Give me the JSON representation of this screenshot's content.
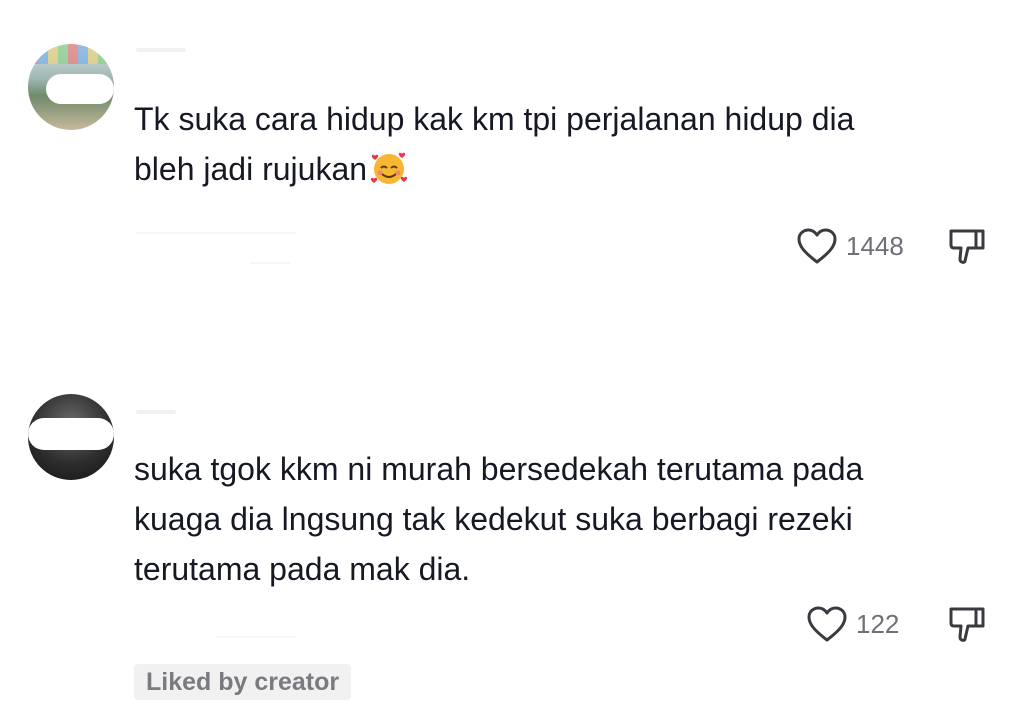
{
  "comments": [
    {
      "avatar_icon": "user-avatar",
      "text": "Tk suka cara hidup kak km tpi perjalanan hidup dia\nbleh jadi rujukan",
      "emoji": "smiling-face-with-hearts",
      "like_icon": "heart-outline-icon",
      "like_count": "1448",
      "dislike_icon": "thumbs-down-icon"
    },
    {
      "avatar_icon": "user-avatar",
      "text": "suka tgok kkm ni murah bersedekah terutama pada\nkuaga dia lngsung tak kedekut suka berbagi rezeki\nterutama pada mak dia.",
      "like_icon": "heart-outline-icon",
      "like_count": "122",
      "dislike_icon": "thumbs-down-icon",
      "liked_by_creator": "Liked by creator"
    }
  ]
}
